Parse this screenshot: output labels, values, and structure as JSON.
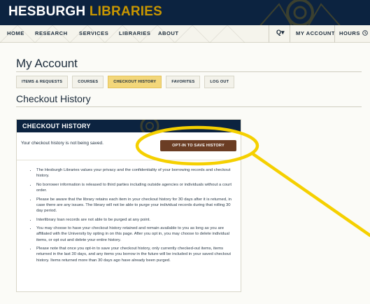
{
  "brand": {
    "part1": "HESBURGH",
    "part2": "LIBRARIES"
  },
  "nav": {
    "items": [
      "HOME",
      "RESEARCH",
      "SERVICES",
      "LIBRARIES",
      "ABOUT"
    ],
    "search_glyph": "Q▾",
    "my_account": "MY ACCOUNT",
    "hours": "HOURS"
  },
  "page": {
    "title": "My Account"
  },
  "tabs": [
    {
      "label": "ITEMS & REQUESTS",
      "active": false
    },
    {
      "label": "COURSES",
      "active": false
    },
    {
      "label": "CHECKOUT HISTORY",
      "active": true
    },
    {
      "label": "FAVORITES",
      "active": false
    },
    {
      "label": "LOG OUT",
      "active": false
    }
  ],
  "section": {
    "title": "Checkout History"
  },
  "card": {
    "header": "CHECKOUT HISTORY",
    "status": "Your checkout history is not being saved.",
    "optin_label": "OPT-IN TO SAVE HISTORY",
    "bullets": [
      "The Hesburgh Libraries values your privacy and the confidentiality of your borrowing records and checkout history.",
      "No borrower information is released to third parties including outside agencies or individuals without a court order.",
      "Please be aware that the library retains each item in your checkout history for 30 days after it is returned, in case there are any issues. The library will not be able to purge your individual records during that rolling 30 day period.",
      "Interlibrary loan records are not able to be purged at any point.",
      "You may choose to have your checkout history retained and remain available to you as long as you are affiliated with the University by opting in on this page. After you opt in, you may choose to delete individual items, or opt out and delete your entire history.",
      "Please note that once you opt-in to save your checkout history, only currently checked-out items, items returned in the last 30 days, and any items you borrow in the future will be included in your saved checkout history. Items returned more than 30 days ago have already been purged."
    ]
  },
  "colors": {
    "navy": "#0c2340",
    "gold": "#c99700",
    "highlight": "#f5d000",
    "button_brown": "#6b3d24",
    "active_tab": "#f3d77a"
  }
}
